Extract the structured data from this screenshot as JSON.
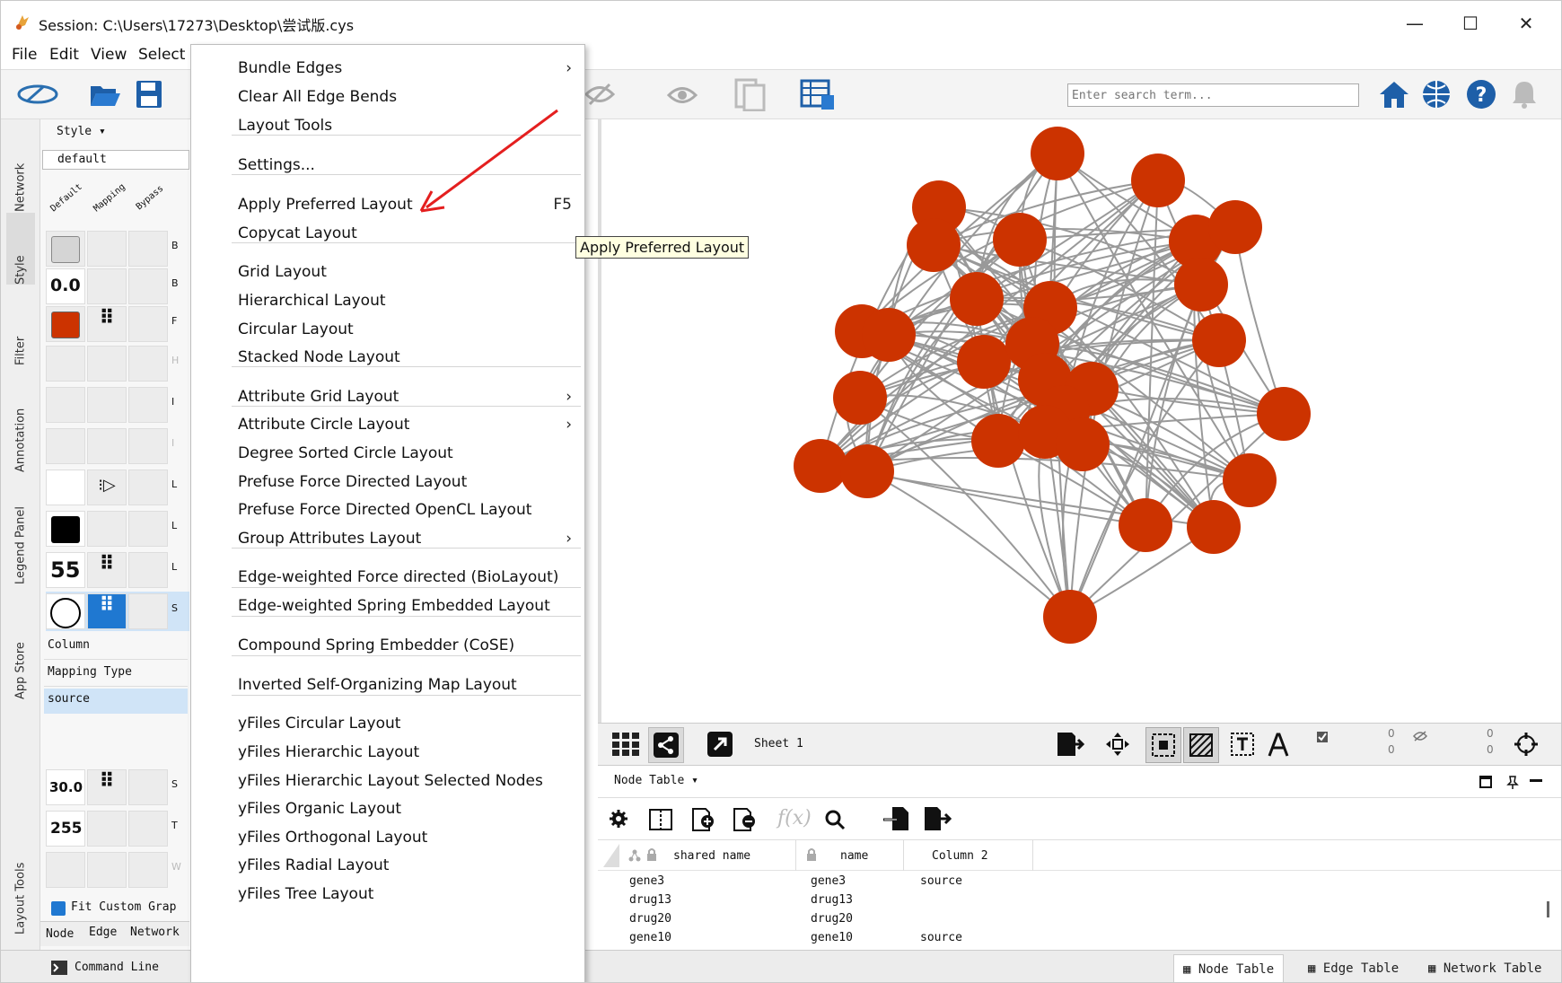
{
  "window": {
    "title": "Session: C:\\Users\\17273\\Desktop\\尝试版.cys",
    "controls": [
      "—",
      "☐",
      "✕"
    ]
  },
  "menubar": [
    "File",
    "Edit",
    "View",
    "Select"
  ],
  "toolbar": {
    "search_placeholder": "Enter search term..."
  },
  "left_tabs": [
    "Network",
    "Style",
    "Filter",
    "Annotation",
    "Legend Panel",
    "App Store",
    "Layout Tools"
  ],
  "style_panel": {
    "header": "Style ▾",
    "style_name": "default",
    "col_headers": [
      "Default",
      "Mapping",
      "Bypass"
    ],
    "row_letters": [
      "B",
      "B",
      "F",
      "H",
      "I",
      "I",
      "L",
      "L",
      "L",
      "S",
      "S",
      "T",
      "W"
    ],
    "values": {
      "border_width": "0.0",
      "label_font_size": "55",
      "size": "30.0",
      "transparency": "255"
    },
    "mapping_labels": [
      "Column",
      "Mapping Type",
      "source"
    ],
    "fit_label": "Fit Custom Grap",
    "bottom_tabs": [
      "Node",
      "Edge",
      "Network"
    ],
    "colors": {
      "fill": "#cc3300",
      "label_color": "#000000",
      "selected_mapping": "#1f78d1"
    }
  },
  "dropdown": {
    "items": [
      {
        "label": "Bundle Edges",
        "submenu": true
      },
      {
        "label": "Clear All Edge Bends"
      },
      {
        "label": "Layout Tools"
      },
      {
        "label": "Settings..."
      },
      {
        "label": "Apply Preferred Layout",
        "shortcut": "F5"
      },
      {
        "label": "Copycat Layout"
      },
      {
        "label": "Grid Layout"
      },
      {
        "label": "Hierarchical Layout"
      },
      {
        "label": "Circular Layout"
      },
      {
        "label": "Stacked Node Layout"
      },
      {
        "label": "Attribute Grid Layout",
        "submenu": true
      },
      {
        "label": "Attribute Circle Layout",
        "submenu": true
      },
      {
        "label": "Degree Sorted Circle Layout"
      },
      {
        "label": "Prefuse Force Directed Layout"
      },
      {
        "label": "Prefuse Force Directed OpenCL Layout"
      },
      {
        "label": "Group Attributes Layout",
        "submenu": true
      },
      {
        "label": "Edge-weighted Force directed (BioLayout)"
      },
      {
        "label": "Edge-weighted Spring Embedded Layout"
      },
      {
        "label": "Compound Spring Embedder (CoSE)"
      },
      {
        "label": "Inverted Self-Organizing Map Layout"
      },
      {
        "label": "yFiles Circular Layout"
      },
      {
        "label": "yFiles Hierarchic Layout"
      },
      {
        "label": "yFiles Hierarchic Layout Selected Nodes"
      },
      {
        "label": "yFiles Organic Layout"
      },
      {
        "label": "yFiles Orthogonal Layout"
      },
      {
        "label": "yFiles Radial Layout"
      },
      {
        "label": "yFiles Tree Layout"
      }
    ]
  },
  "tooltip": "Apply Preferred Layout",
  "network_bar": {
    "sheet": "Sheet 1",
    "counts": [
      "0",
      "0",
      "0",
      "0"
    ]
  },
  "table_panel": {
    "title": "Node Table ▾",
    "fx": "f(x)",
    "columns": [
      "shared name",
      "name",
      "Column 2"
    ],
    "rows": [
      [
        "gene3",
        "gene3",
        "source"
      ],
      [
        "drug13",
        "drug13",
        ""
      ],
      [
        "drug20",
        "drug20",
        ""
      ],
      [
        "gene10",
        "gene10",
        "source"
      ]
    ]
  },
  "statusbar": {
    "command_line": "Command Line",
    "tabs": [
      "Node Table",
      "Edge Table",
      "Network Table"
    ]
  },
  "network": {
    "node_color": "#cc3300",
    "edge_color": "#999999"
  }
}
